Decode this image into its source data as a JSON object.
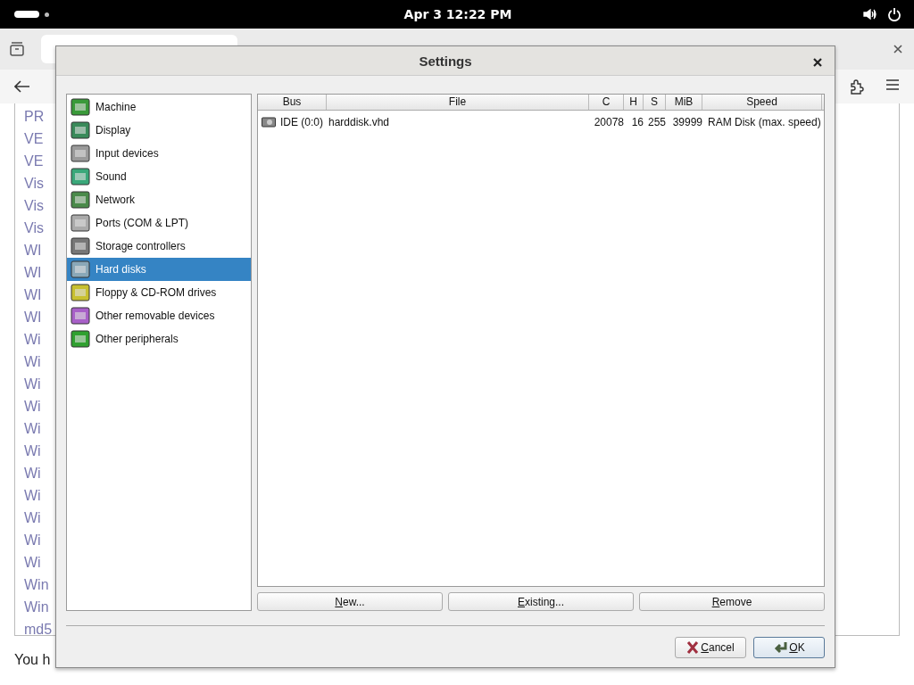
{
  "top_bar": {
    "clock": "Apr 3  12:22 PM"
  },
  "browser": {
    "links": [
      "PR",
      "VE",
      "VE",
      "Vis",
      "Vis",
      "Vis",
      "WI",
      "WI",
      "WI",
      "WI",
      "Wi",
      "Wi",
      "Wi",
      "Wi",
      "Wi",
      "Wi",
      "Wi",
      "Wi",
      "Wi",
      "Wi",
      "Wi",
      "Win",
      "Win",
      "md5"
    ],
    "footer_text": "You h"
  },
  "dialog": {
    "title": "Settings",
    "categories": [
      {
        "label": "Machine",
        "selected": false
      },
      {
        "label": "Display",
        "selected": false
      },
      {
        "label": "Input devices",
        "selected": false
      },
      {
        "label": "Sound",
        "selected": false
      },
      {
        "label": "Network",
        "selected": false
      },
      {
        "label": "Ports (COM & LPT)",
        "selected": false
      },
      {
        "label": "Storage controllers",
        "selected": false
      },
      {
        "label": "Hard disks",
        "selected": true
      },
      {
        "label": "Floppy & CD-ROM drives",
        "selected": false
      },
      {
        "label": "Other removable devices",
        "selected": false
      },
      {
        "label": "Other peripherals",
        "selected": false
      }
    ],
    "table": {
      "columns": [
        "Bus",
        "File",
        "C",
        "H",
        "S",
        "MiB",
        "Speed"
      ],
      "rows": [
        {
          "cells": [
            "IDE (0:0)",
            "harddisk.vhd",
            "20078",
            "16",
            "255",
            "39999",
            "RAM Disk (max. speed)"
          ],
          "selected": false
        }
      ]
    },
    "disk_buttons": [
      "New...",
      "Existing...",
      "Remove"
    ],
    "cancel_button": "Cancel",
    "ok_button": "OK"
  }
}
